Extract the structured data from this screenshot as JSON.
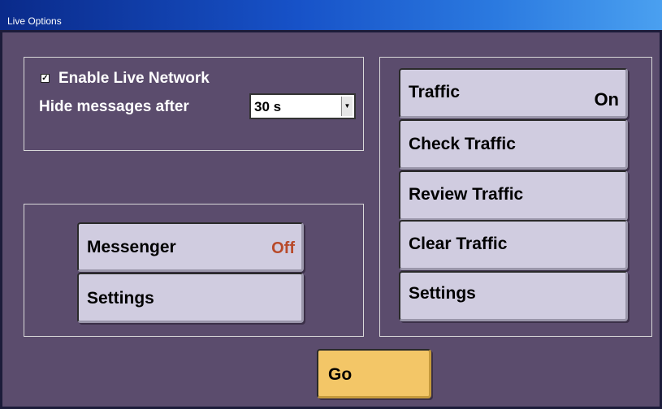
{
  "window": {
    "title": "Live Options"
  },
  "network": {
    "enable_checked": true,
    "checkbox_glyph": "☑",
    "enable_label": "Enable Live Network",
    "hide_label": "Hide messages after",
    "hide_value": "30 s"
  },
  "messenger": {
    "button_label": "Messenger",
    "status": "Off",
    "status_color": "#b84a2a",
    "settings_label": "Settings"
  },
  "traffic": {
    "button_label": "Traffic",
    "status": "On",
    "status_color": "#000000",
    "check_label": "Check Traffic",
    "review_label": "Review Traffic",
    "clear_label": "Clear Traffic",
    "settings_label": "Settings"
  },
  "go_label": "Go",
  "colors": {
    "background": "#5b4c6d",
    "button": "#d0cce0",
    "go_button": "#f3c667"
  }
}
